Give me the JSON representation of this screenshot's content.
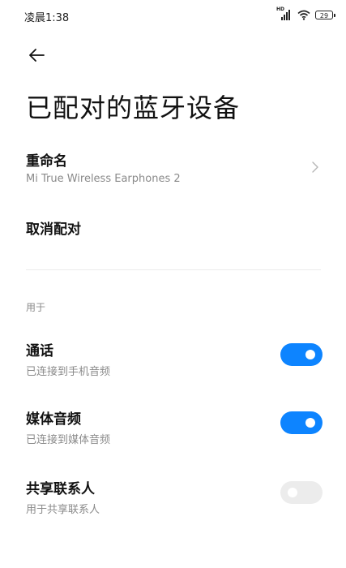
{
  "status_bar": {
    "time": "凌晨1:38",
    "network_label": "HD",
    "battery": "29",
    "icons": [
      "signal-icon",
      "wifi-icon",
      "battery-icon"
    ]
  },
  "header": {
    "back_icon": "back-arrow-icon",
    "title": "已配对的蓝牙设备"
  },
  "rename": {
    "label": "重命名",
    "value": "Mi True Wireless Earphones 2"
  },
  "unpair": {
    "label": "取消配对"
  },
  "section": {
    "label": "用于"
  },
  "options": [
    {
      "title": "通话",
      "subtitle": "已连接到手机音频",
      "enabled": true
    },
    {
      "title": "媒体音频",
      "subtitle": "已连接到媒体音频",
      "enabled": true
    },
    {
      "title": "共享联系人",
      "subtitle": "用于共享联系人",
      "enabled": false
    }
  ],
  "colors": {
    "accent": "#0d84ff",
    "toggle_off": "#ececec",
    "subtitle": "#8a8a8a"
  }
}
